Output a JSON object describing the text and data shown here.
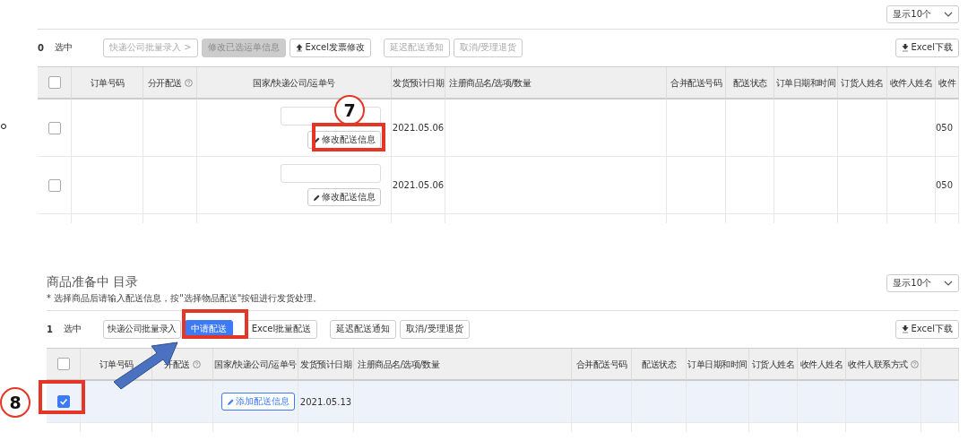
{
  "panels": [
    {
      "page_size": "显示10个",
      "selected_count": "0",
      "selected_label": "选中",
      "toolbar": [
        {
          "label": "快递公司批量录入 >",
          "kind": "outline",
          "disabled": true
        },
        {
          "label": "修改已选运单信息",
          "kind": "filled",
          "disabled": true
        },
        {
          "label": "Excel发票修改",
          "kind": "upload",
          "disabled": false
        },
        {
          "label": "延迟配送通知",
          "kind": "outline",
          "disabled": true
        },
        {
          "label": "取消/受理退货",
          "kind": "outline",
          "disabled": true
        }
      ],
      "download": "Excel下载",
      "columns": [
        {
          "kind": "checkbox",
          "checked": false
        },
        {
          "label": "订单号码",
          "help": false
        },
        {
          "label": "分开配送",
          "help": true
        },
        {
          "label": "国家/快递公司/运单号",
          "help": false
        },
        {
          "label": "发货预计日期",
          "help": false
        },
        {
          "label": "注册商品名/选项/数量",
          "help": false
        },
        {
          "label": "合并配送号码",
          "help": false
        },
        {
          "label": "配送状态",
          "help": false
        },
        {
          "label": "订单日期和时间",
          "help": false
        },
        {
          "label": "订货人姓名",
          "help": false
        },
        {
          "label": "收件人姓名",
          "help": false
        },
        {
          "label": "收件",
          "help": false
        }
      ],
      "rows": [
        {
          "checked": false,
          "selected": false,
          "kind": "edit",
          "action": "修改配送信息",
          "date": "2021.05.06",
          "last": "050"
        },
        {
          "checked": false,
          "selected": false,
          "kind": "edit",
          "action": "修改配送信息",
          "date": "2021.05.06",
          "last": "050"
        }
      ]
    },
    {
      "title": "商品准备中 目录",
      "note": "* 选择商品后请输入配送信息，按\"选择物品配送\"按钮进行发货处理。",
      "page_size": "显示10个",
      "selected_count": "1",
      "selected_label": "选中",
      "toolbar": [
        {
          "label": "快递公司批量录入",
          "kind": "outline",
          "disabled": false
        },
        {
          "label": "中请配送",
          "kind": "primary",
          "disabled": false
        },
        {
          "label": "Excel批量配送",
          "kind": "outline",
          "disabled": false
        },
        {
          "label": "延迟配送通知",
          "kind": "outline",
          "disabled": false
        },
        {
          "label": "取消/受理退货",
          "kind": "outline",
          "disabled": false
        }
      ],
      "download": "Excel下载",
      "columns": [
        {
          "kind": "checkbox",
          "checked": false
        },
        {
          "label": "订单号码",
          "help": false
        },
        {
          "label": "开配送",
          "help": true
        },
        {
          "label": "国家/快递公司/运单号",
          "help": false
        },
        {
          "label": "发货预计日期",
          "help": false
        },
        {
          "label": "注册商品名/选项/数量",
          "help": false
        },
        {
          "label": "合并配送号码",
          "help": false
        },
        {
          "label": "配送状态",
          "help": false
        },
        {
          "label": "订单日期和时间",
          "help": false
        },
        {
          "label": "订货人姓名",
          "help": false
        },
        {
          "label": "收件人姓名",
          "help": false
        },
        {
          "label": "收件人联系方式",
          "help": true
        },
        {
          "kind": "blank"
        }
      ],
      "rows": [
        {
          "checked": true,
          "selected": true,
          "kind": "add",
          "action": "添加配送信息",
          "date": "2021.05.13",
          "last": ""
        }
      ]
    }
  ],
  "annotations": [
    {
      "kind": "badge",
      "label": "7"
    },
    {
      "kind": "frame"
    },
    {
      "kind": "badge",
      "label": "8"
    },
    {
      "kind": "frame"
    },
    {
      "kind": "frame"
    },
    {
      "kind": "arrow"
    }
  ]
}
